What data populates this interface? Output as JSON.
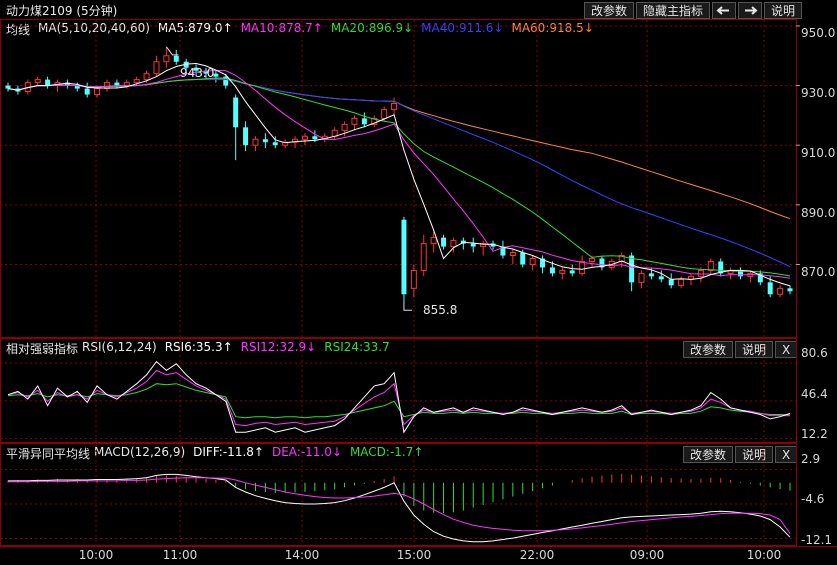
{
  "title": "动力煤2109 (5分钟)",
  "toolbar": {
    "params_label": "改参数",
    "hide_indicator_label": "隐藏主指标",
    "prev_icon": "arrow-left-icon",
    "next_icon": "arrow-right-icon",
    "help_label": "说明"
  },
  "main_legend": {
    "name": "均线",
    "ma_label": "MA(5,10,20,40,60)",
    "ma5": "MA5:879.0↑",
    "ma10": "MA10:878.7↑",
    "ma20": "MA20:896.9↓",
    "ma40": "MA40:911.6↓",
    "ma60": "MA60:918.5↓"
  },
  "rsi_panel": {
    "name": "相对强弱指标",
    "params": "RSI(6,12,24)",
    "rsi6": "RSI6:35.3↑",
    "rsi12": "RSI12:32.9↓",
    "rsi24": "RSI24:33.7",
    "params_label": "改参数",
    "help_label": "说明",
    "close_label": "X"
  },
  "macd_panel": {
    "name": "平滑异同平均线",
    "params": "MACD(12,26,9)",
    "diff": "DIFF:-11.8↑",
    "dea": "DEA:-11.0↓",
    "macd": "MACD:-1.7↑",
    "params_label": "改参数",
    "help_label": "说明",
    "close_label": "X"
  },
  "colors": {
    "up": "#ff3232",
    "down": "#54ffff",
    "ma5": "#ffffff",
    "ma10": "#ff33ff",
    "ma20": "#33dd33",
    "ma40": "#3344ff",
    "ma60": "#ff8833",
    "grid": "#8b0000"
  },
  "chart_data": [
    {
      "type": "candlestick",
      "yticks": [
        "950.0",
        "930.0",
        "910.0",
        "890.0",
        "870.0"
      ],
      "ylim": [
        846,
        952
      ],
      "x_ticks": [
        "10:00",
        "11:00",
        "14:00",
        "15:00",
        "22:00",
        "09:00",
        "10:00"
      ],
      "annotations": {
        "high": "943.0",
        "low": "855.8"
      },
      "candles": [
        [
          930,
          931,
          928,
          929
        ],
        [
          929,
          930,
          927,
          928
        ],
        [
          928,
          932,
          927,
          931
        ],
        [
          931,
          933,
          930,
          932
        ],
        [
          932,
          933,
          929,
          930
        ],
        [
          930,
          932,
          928,
          931
        ],
        [
          931,
          932,
          929,
          930
        ],
        [
          930,
          931,
          928,
          929
        ],
        [
          929,
          931,
          926,
          927
        ],
        [
          927,
          930,
          926,
          929
        ],
        [
          929,
          932,
          928,
          931
        ],
        [
          931,
          932,
          929,
          930
        ],
        [
          930,
          932,
          929,
          931
        ],
        [
          931,
          933,
          930,
          932
        ],
        [
          932,
          935,
          931,
          934
        ],
        [
          934,
          940,
          933,
          938
        ],
        [
          938,
          943,
          936,
          940
        ],
        [
          940,
          942,
          937,
          938
        ],
        [
          938,
          939,
          935,
          936
        ],
        [
          936,
          937,
          933,
          935
        ],
        [
          935,
          936,
          932,
          934
        ],
        [
          934,
          935,
          931,
          933
        ],
        [
          933,
          934,
          929,
          930
        ],
        [
          926,
          927,
          905,
          916
        ],
        [
          916,
          918,
          908,
          910
        ],
        [
          910,
          913,
          908,
          912
        ],
        [
          912,
          914,
          909,
          911
        ],
        [
          911,
          913,
          909,
          910
        ],
        [
          910,
          912,
          909,
          911
        ],
        [
          911,
          913,
          909,
          912
        ],
        [
          912,
          914,
          910,
          913
        ],
        [
          913,
          915,
          911,
          912
        ],
        [
          912,
          914,
          911,
          913
        ],
        [
          913,
          916,
          912,
          915
        ],
        [
          915,
          918,
          913,
          917
        ],
        [
          917,
          920,
          915,
          919
        ],
        [
          919,
          921,
          916,
          917
        ],
        [
          917,
          920,
          916,
          919
        ],
        [
          919,
          923,
          918,
          922
        ],
        [
          922,
          926,
          920,
          924
        ],
        [
          885,
          886,
          858,
          860
        ],
        [
          862,
          870,
          859,
          868
        ],
        [
          868,
          880,
          866,
          877
        ],
        [
          877,
          881,
          874,
          879
        ],
        [
          879,
          880,
          875,
          876
        ],
        [
          876,
          879,
          874,
          878
        ],
        [
          878,
          879,
          875,
          877
        ],
        [
          877,
          879,
          874,
          876
        ],
        [
          876,
          878,
          873,
          877
        ],
        [
          877,
          878,
          875,
          876
        ],
        [
          876,
          878,
          872,
          873
        ],
        [
          873,
          875,
          870,
          874
        ],
        [
          874,
          875,
          869,
          870
        ],
        [
          870,
          873,
          868,
          872
        ],
        [
          872,
          873,
          867,
          869
        ],
        [
          869,
          871,
          866,
          867
        ],
        [
          867,
          869,
          865,
          868
        ],
        [
          868,
          870,
          866,
          867
        ],
        [
          867,
          873,
          866,
          871
        ],
        [
          871,
          873,
          869,
          872
        ],
        [
          872,
          873,
          868,
          869
        ],
        [
          869,
          872,
          868,
          871
        ],
        [
          871,
          874,
          869,
          873
        ],
        [
          873,
          874,
          861,
          864
        ],
        [
          864,
          868,
          862,
          867
        ],
        [
          867,
          869,
          865,
          866
        ],
        [
          866,
          868,
          864,
          865
        ],
        [
          865,
          867,
          862,
          863
        ],
        [
          863,
          866,
          862,
          865
        ],
        [
          865,
          867,
          863,
          866
        ],
        [
          866,
          869,
          864,
          868
        ],
        [
          868,
          872,
          867,
          871
        ],
        [
          871,
          872,
          866,
          867
        ],
        [
          867,
          869,
          865,
          868
        ],
        [
          868,
          869,
          865,
          866
        ],
        [
          866,
          868,
          864,
          867
        ],
        [
          867,
          868,
          863,
          864
        ],
        [
          864,
          866,
          859,
          860
        ],
        [
          860,
          863,
          859,
          862
        ],
        [
          862,
          863,
          860,
          861
        ]
      ]
    },
    {
      "type": "line",
      "name": "RSI",
      "yticks": [
        "80.6",
        "46.4",
        "12.2"
      ],
      "ylim": [
        10,
        88
      ],
      "series": [
        {
          "name": "RSI6",
          "values": [
            52,
            55,
            48,
            60,
            42,
            58,
            50,
            55,
            45,
            60,
            52,
            48,
            55,
            62,
            70,
            82,
            74,
            80,
            70,
            62,
            58,
            52,
            46,
            18,
            18,
            20,
            22,
            18,
            20,
            22,
            18,
            20,
            22,
            24,
            30,
            40,
            50,
            60,
            62,
            72,
            18,
            32,
            40,
            36,
            38,
            40,
            36,
            40,
            38,
            36,
            34,
            36,
            40,
            38,
            36,
            34,
            36,
            38,
            40,
            38,
            36,
            38,
            42,
            34,
            36,
            38,
            36,
            34,
            36,
            38,
            42,
            54,
            48,
            40,
            38,
            36,
            34,
            30,
            32,
            35
          ]
        },
        {
          "name": "RSI12",
          "values": [
            52,
            54,
            50,
            56,
            46,
            54,
            50,
            52,
            48,
            56,
            52,
            50,
            54,
            58,
            64,
            74,
            70,
            72,
            66,
            60,
            56,
            52,
            48,
            25,
            24,
            26,
            27,
            25,
            26,
            27,
            25,
            26,
            27,
            28,
            32,
            38,
            44,
            50,
            54,
            62,
            25,
            33,
            38,
            36,
            37,
            38,
            36,
            38,
            37,
            36,
            35,
            36,
            38,
            37,
            36,
            35,
            36,
            37,
            38,
            37,
            36,
            37,
            40,
            35,
            36,
            37,
            36,
            35,
            36,
            37,
            40,
            48,
            45,
            40,
            38,
            37,
            35,
            33,
            33,
            32.9
          ]
        },
        {
          "name": "RSI24",
          "values": [
            51,
            52,
            51,
            53,
            50,
            52,
            51,
            52,
            50,
            53,
            52,
            51,
            52,
            54,
            57,
            62,
            61,
            62,
            59,
            56,
            54,
            52,
            50,
            32,
            31,
            32,
            32,
            31,
            32,
            32,
            31,
            32,
            32,
            33,
            34,
            36,
            38,
            40,
            42,
            46,
            32,
            34,
            36,
            35,
            35,
            36,
            35,
            36,
            35,
            35,
            35,
            35,
            36,
            35,
            35,
            34,
            35,
            35,
            36,
            35,
            35,
            35,
            37,
            34,
            35,
            35,
            35,
            34,
            35,
            35,
            37,
            41,
            40,
            38,
            37,
            36,
            35,
            34,
            34,
            33.7
          ]
        }
      ]
    },
    {
      "type": "bar_line",
      "name": "MACD",
      "yticks": [
        "2.9",
        "-4.6",
        "-12.1"
      ],
      "ylim": [
        -13.5,
        4.5
      ],
      "series": [
        {
          "name": "MACD",
          "values": [
            0.5,
            0.6,
            0.5,
            0.7,
            0.6,
            0.8,
            0.7,
            0.8,
            0.6,
            0.8,
            0.8,
            0.7,
            0.9,
            1.0,
            1.2,
            1.6,
            1.6,
            1.5,
            1.3,
            1.0,
            0.8,
            0.6,
            0.4,
            -0.8,
            -1.4,
            -1.8,
            -2.0,
            -2.2,
            -2.2,
            -2.1,
            -2.0,
            -1.8,
            -1.6,
            -1.4,
            -1.0,
            -0.6,
            -0.2,
            0.4,
            0.8,
            1.4,
            -3.0,
            -5.0,
            -6.0,
            -6.5,
            -6.6,
            -6.4,
            -6.0,
            -5.4,
            -4.8,
            -4.2,
            -3.6,
            -3.0,
            -2.4,
            -1.8,
            -1.2,
            -0.6,
            0.0,
            0.6,
            1.0,
            1.3,
            1.6,
            1.8,
            1.9,
            1.8,
            1.6,
            1.4,
            1.2,
            1.0,
            0.9,
            0.8,
            0.9,
            1.1,
            1.0,
            0.6,
            0.2,
            -0.2,
            -0.6,
            -1.0,
            -1.4,
            -1.7
          ]
        },
        {
          "name": "DIFF",
          "values": [
            0.4,
            0.4,
            0.4,
            0.5,
            0.5,
            0.6,
            0.6,
            0.6,
            0.6,
            0.7,
            0.7,
            0.7,
            0.8,
            0.9,
            1.1,
            1.6,
            1.8,
            1.8,
            1.6,
            1.3,
            1.1,
            0.9,
            0.6,
            -1.0,
            -2.0,
            -2.8,
            -3.4,
            -3.9,
            -4.3,
            -4.5,
            -4.6,
            -4.6,
            -4.5,
            -4.3,
            -3.9,
            -3.3,
            -2.6,
            -1.8,
            -1.0,
            0.0,
            -4.0,
            -7.0,
            -9.0,
            -10.6,
            -11.6,
            -12.2,
            -12.6,
            -12.8,
            -12.8,
            -12.6,
            -12.3,
            -12.0,
            -11.6,
            -11.2,
            -10.8,
            -10.4,
            -10.0,
            -9.6,
            -9.2,
            -8.8,
            -8.4,
            -8.0,
            -7.6,
            -7.4,
            -7.3,
            -7.2,
            -7.1,
            -7.0,
            -6.9,
            -6.8,
            -6.6,
            -6.3,
            -6.2,
            -6.3,
            -6.5,
            -6.8,
            -7.2,
            -8.0,
            -9.6,
            -11.8
          ]
        },
        {
          "name": "DEA",
          "values": [
            0.2,
            0.2,
            0.2,
            0.3,
            0.3,
            0.3,
            0.3,
            0.4,
            0.4,
            0.4,
            0.4,
            0.4,
            0.5,
            0.5,
            0.6,
            0.8,
            0.9,
            1.0,
            1.1,
            1.1,
            1.1,
            1.0,
            1.0,
            0.6,
            0.0,
            -0.5,
            -1.0,
            -1.5,
            -2.0,
            -2.4,
            -2.7,
            -3.0,
            -3.2,
            -3.3,
            -3.3,
            -3.2,
            -3.1,
            -2.9,
            -2.6,
            -2.3,
            -2.6,
            -3.5,
            -4.6,
            -5.8,
            -6.9,
            -7.9,
            -8.6,
            -9.2,
            -9.6,
            -9.9,
            -10.1,
            -10.3,
            -10.4,
            -10.4,
            -10.4,
            -10.3,
            -10.2,
            -10.0,
            -9.8,
            -9.5,
            -9.3,
            -9.0,
            -8.7,
            -8.4,
            -8.2,
            -8.0,
            -7.8,
            -7.6,
            -7.4,
            -7.3,
            -7.1,
            -6.9,
            -6.7,
            -6.6,
            -6.6,
            -6.6,
            -6.7,
            -7.0,
            -8.0,
            -11.0
          ]
        }
      ]
    }
  ]
}
